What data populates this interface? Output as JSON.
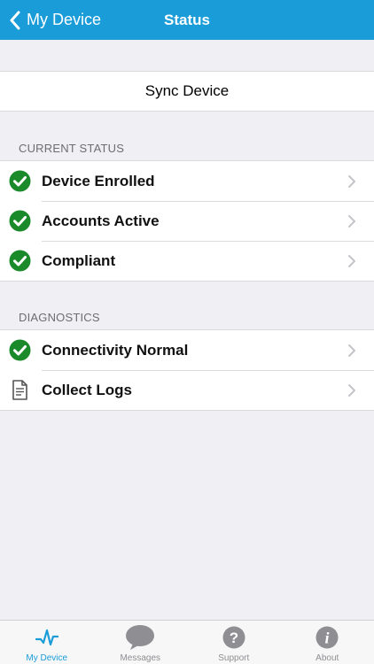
{
  "navbar": {
    "back_label": "My Device",
    "title": "Status"
  },
  "sync": {
    "label": "Sync Device"
  },
  "current_status": {
    "header": "CURRENT STATUS",
    "items": [
      {
        "label": "Device Enrolled",
        "icon": "check-circle-icon"
      },
      {
        "label": "Accounts Active",
        "icon": "check-circle-icon"
      },
      {
        "label": "Compliant",
        "icon": "check-circle-icon"
      }
    ]
  },
  "diagnostics": {
    "header": "DIAGNOSTICS",
    "items": [
      {
        "label": "Connectivity Normal",
        "icon": "check-circle-icon"
      },
      {
        "label": "Collect Logs",
        "icon": "document-icon"
      }
    ]
  },
  "tabbar": {
    "tabs": [
      {
        "label": "My Device",
        "icon": "pulse-icon",
        "active": true
      },
      {
        "label": "Messages",
        "icon": "speech-bubble-icon",
        "active": false
      },
      {
        "label": "Support",
        "icon": "question-icon",
        "active": false
      },
      {
        "label": "About",
        "icon": "info-icon",
        "active": false
      }
    ]
  },
  "colors": {
    "accent": "#1a9cd8",
    "status_ok": "#1a8a2a",
    "background": "#efeff4",
    "tab_inactive": "#8e8e93"
  }
}
